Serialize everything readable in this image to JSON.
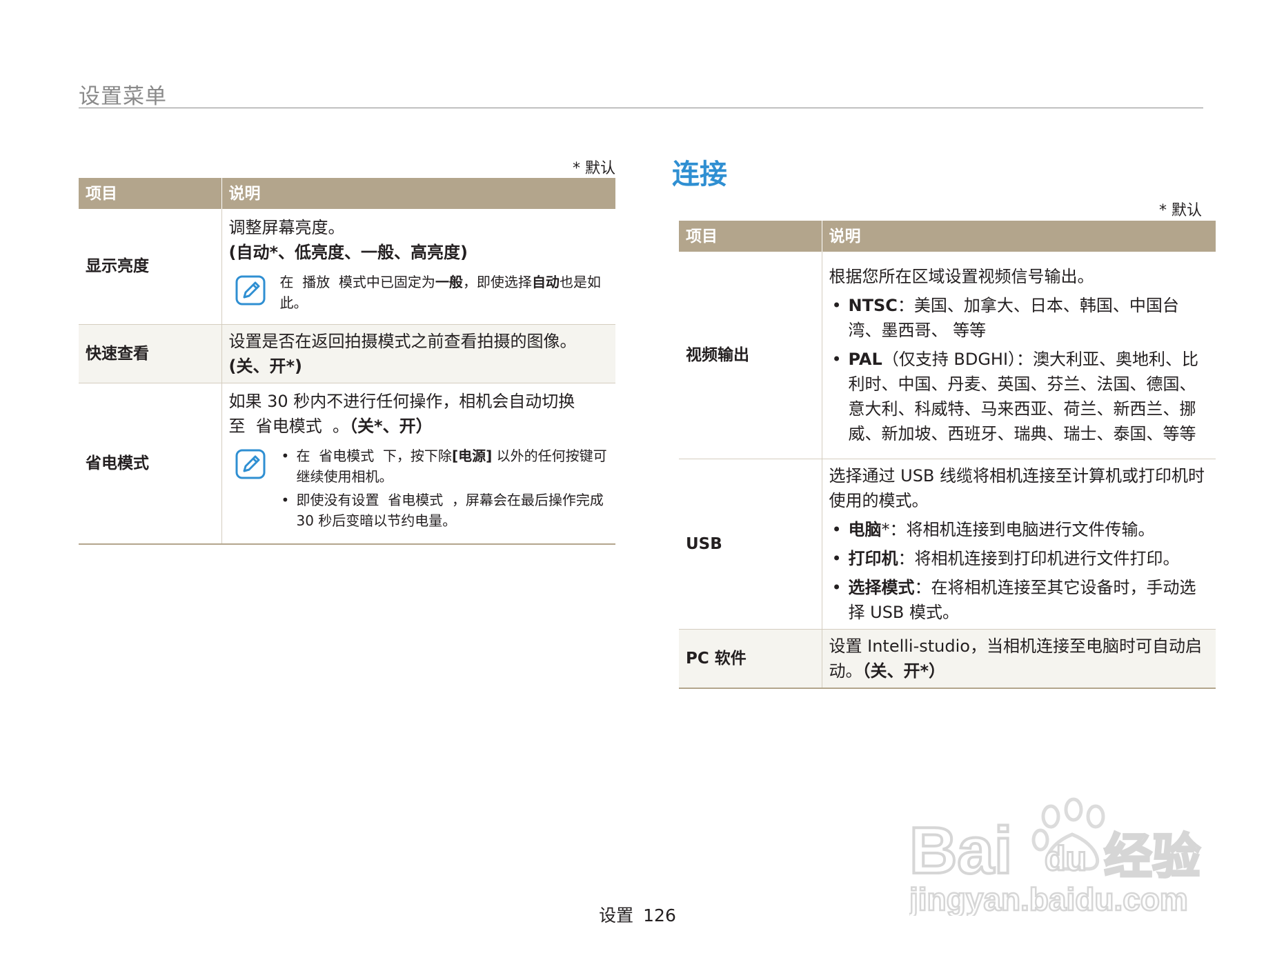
{
  "header": {
    "title": "设置菜单"
  },
  "left": {
    "default_note": "* 默认",
    "columns": [
      "项目",
      "说明"
    ],
    "rows": [
      {
        "item": "显示亮度",
        "line1": "调整屏幕亮度。",
        "options": "(自动*、低亮度、一般、高亮度)",
        "note": {
          "a": "在",
          "b": "播放",
          "c": "模式中已固定为",
          "d": "一般",
          "e": "，即使选择",
          "f": "自动",
          "g": "也是如此。"
        }
      },
      {
        "item": "快速查看",
        "text": "设置是否在返回拍摄模式之前查看拍摄的图像。",
        "options": "(关、开*)"
      },
      {
        "item": "省电模式",
        "text": "如果 30 秒内不进行任何操作，相机会自动切换至",
        "text_mode": "省电模式",
        "text_end": "。",
        "options": "（关*、开）",
        "notes": [
          {
            "a": "在",
            "b": "省电模式",
            "c": "下，按下除",
            "d": "[电源]",
            "e": "以外的任何按键可继续使用相机。"
          },
          {
            "a": "即使没有设置",
            "b": "省电模式",
            "c": "，屏幕会在最后操作完成 30 秒后变暗以节约电量。"
          }
        ]
      }
    ]
  },
  "right": {
    "section_title": "连接",
    "default_note": "* 默认",
    "columns": [
      "项目",
      "说明"
    ],
    "rows": [
      {
        "item": "视频输出",
        "intro": "根据您所在区域设置视频信号输出。",
        "bullets": [
          {
            "label": "NTSC",
            "text": "：美国、加拿大、日本、韩国、中国台湾、墨西哥、 等等"
          },
          {
            "label": "PAL",
            "text": "（仅支持 BDGHI）：澳大利亚、奥地利、比利时、中国、丹麦、英国、芬兰、法国、德国、意大利、科威特、马来西亚、荷兰、新西兰、挪威、新加坡、西班牙、瑞典、瑞士、泰国、等等"
          }
        ]
      },
      {
        "item": "USB",
        "intro": "选择通过 USB 线缆将相机连接至计算机或打印机时使用的模式。",
        "bullets": [
          {
            "label": "电脑",
            "text": "*：将相机连接到电脑进行文件传输。"
          },
          {
            "label": "打印机",
            "text": "：将相机连接到打印机进行文件打印。"
          },
          {
            "label": "选择模式",
            "text": "：在将相机连接至其它设备时，手动选择 USB 模式。"
          }
        ]
      },
      {
        "item": "PC 软件",
        "text": "设置 Intelli-studio，当相机连接至电脑时可自动启动。",
        "options": "（关、开*）"
      }
    ]
  },
  "footer": {
    "section": "设置",
    "page": "126"
  },
  "watermark": {
    "brand": "Bai du 经验",
    "url": "jingyan.baidu.com"
  },
  "colors": {
    "table_header": "#b3a58c",
    "section_title": "#2f8fd2",
    "note_icon": "#2f8fd2"
  }
}
